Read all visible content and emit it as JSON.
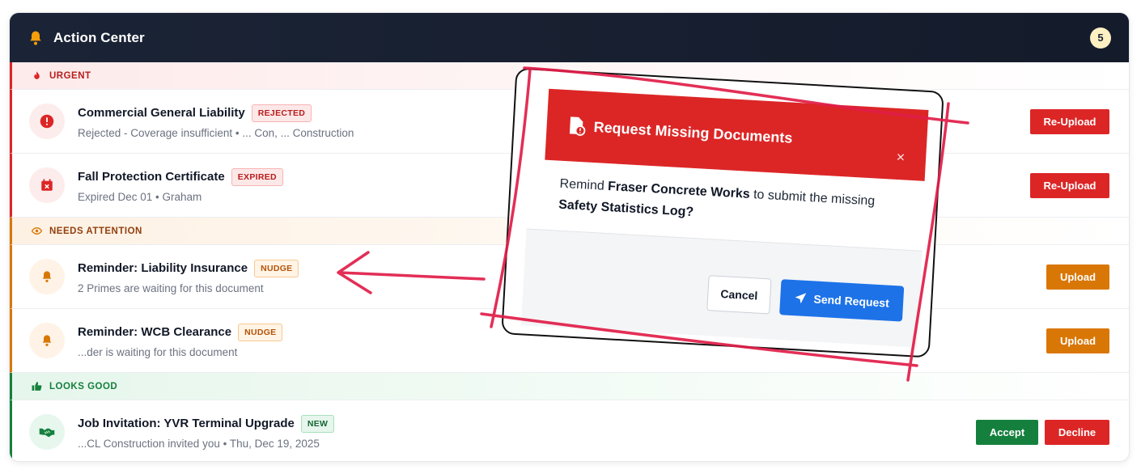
{
  "header": {
    "title": "Action Center",
    "count": "5"
  },
  "sections": {
    "urgent": "URGENT",
    "attention": "NEEDS ATTENTION",
    "good": "LOOKS GOOD"
  },
  "rows": [
    {
      "title": "Commercial General Liability",
      "tag": "REJECTED",
      "sub": "Rejected - Coverage insufficient • ... Con, ... Construction",
      "action": "Re-Upload",
      "icon": "alert-circle-icon"
    },
    {
      "title": "Fall Protection Certificate",
      "tag": "EXPIRED",
      "sub": "Expired Dec 01 • Graham",
      "action": "Re-Upload",
      "icon": "calendar-x-icon"
    },
    {
      "title": "Reminder: Liability Insurance",
      "tag": "NUDGE",
      "sub": "2 Primes are waiting for this document",
      "action": "Upload",
      "icon": "bell-icon"
    },
    {
      "title": "Reminder: WCB Clearance",
      "tag": "NUDGE",
      "sub": "...der is waiting for this document",
      "action": "Upload",
      "icon": "bell-icon"
    },
    {
      "title": "Job Invitation: YVR Terminal Upgrade",
      "tag": "NEW",
      "sub": "...CL Construction invited you • Thu, Dec 19, 2025",
      "accept": "Accept",
      "decline": "Decline",
      "icon": "handshake-icon"
    }
  ],
  "modal": {
    "title": "Request Missing Documents",
    "close": "×",
    "body_prefix": "Remind ",
    "company": "Fraser Concrete Works",
    "body_mid": " to submit the missing ",
    "document": "Safety Statistics Log?",
    "cancel": "Cancel",
    "send": "Send Request"
  },
  "colors": {
    "urgent": "#dc2626",
    "attention": "#d97706",
    "good": "#15803d",
    "header": "#1b2436",
    "annotation": "#e11d48"
  }
}
